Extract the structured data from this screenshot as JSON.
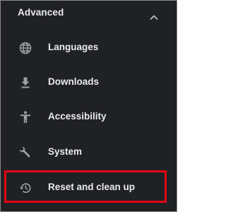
{
  "section": {
    "title": "Advanced",
    "expanded": true
  },
  "items": [
    {
      "label": "Languages",
      "icon": "globe-icon"
    },
    {
      "label": "Downloads",
      "icon": "download-icon"
    },
    {
      "label": "Accessibility",
      "icon": "accessibility-icon"
    },
    {
      "label": "System",
      "icon": "wrench-icon"
    },
    {
      "label": "Reset and clean up",
      "icon": "restore-icon",
      "highlighted": true
    }
  ],
  "colors": {
    "background": "#202124",
    "text": "#e8eaed",
    "icon": "#9aa0a6",
    "highlight_border": "#e30613"
  }
}
